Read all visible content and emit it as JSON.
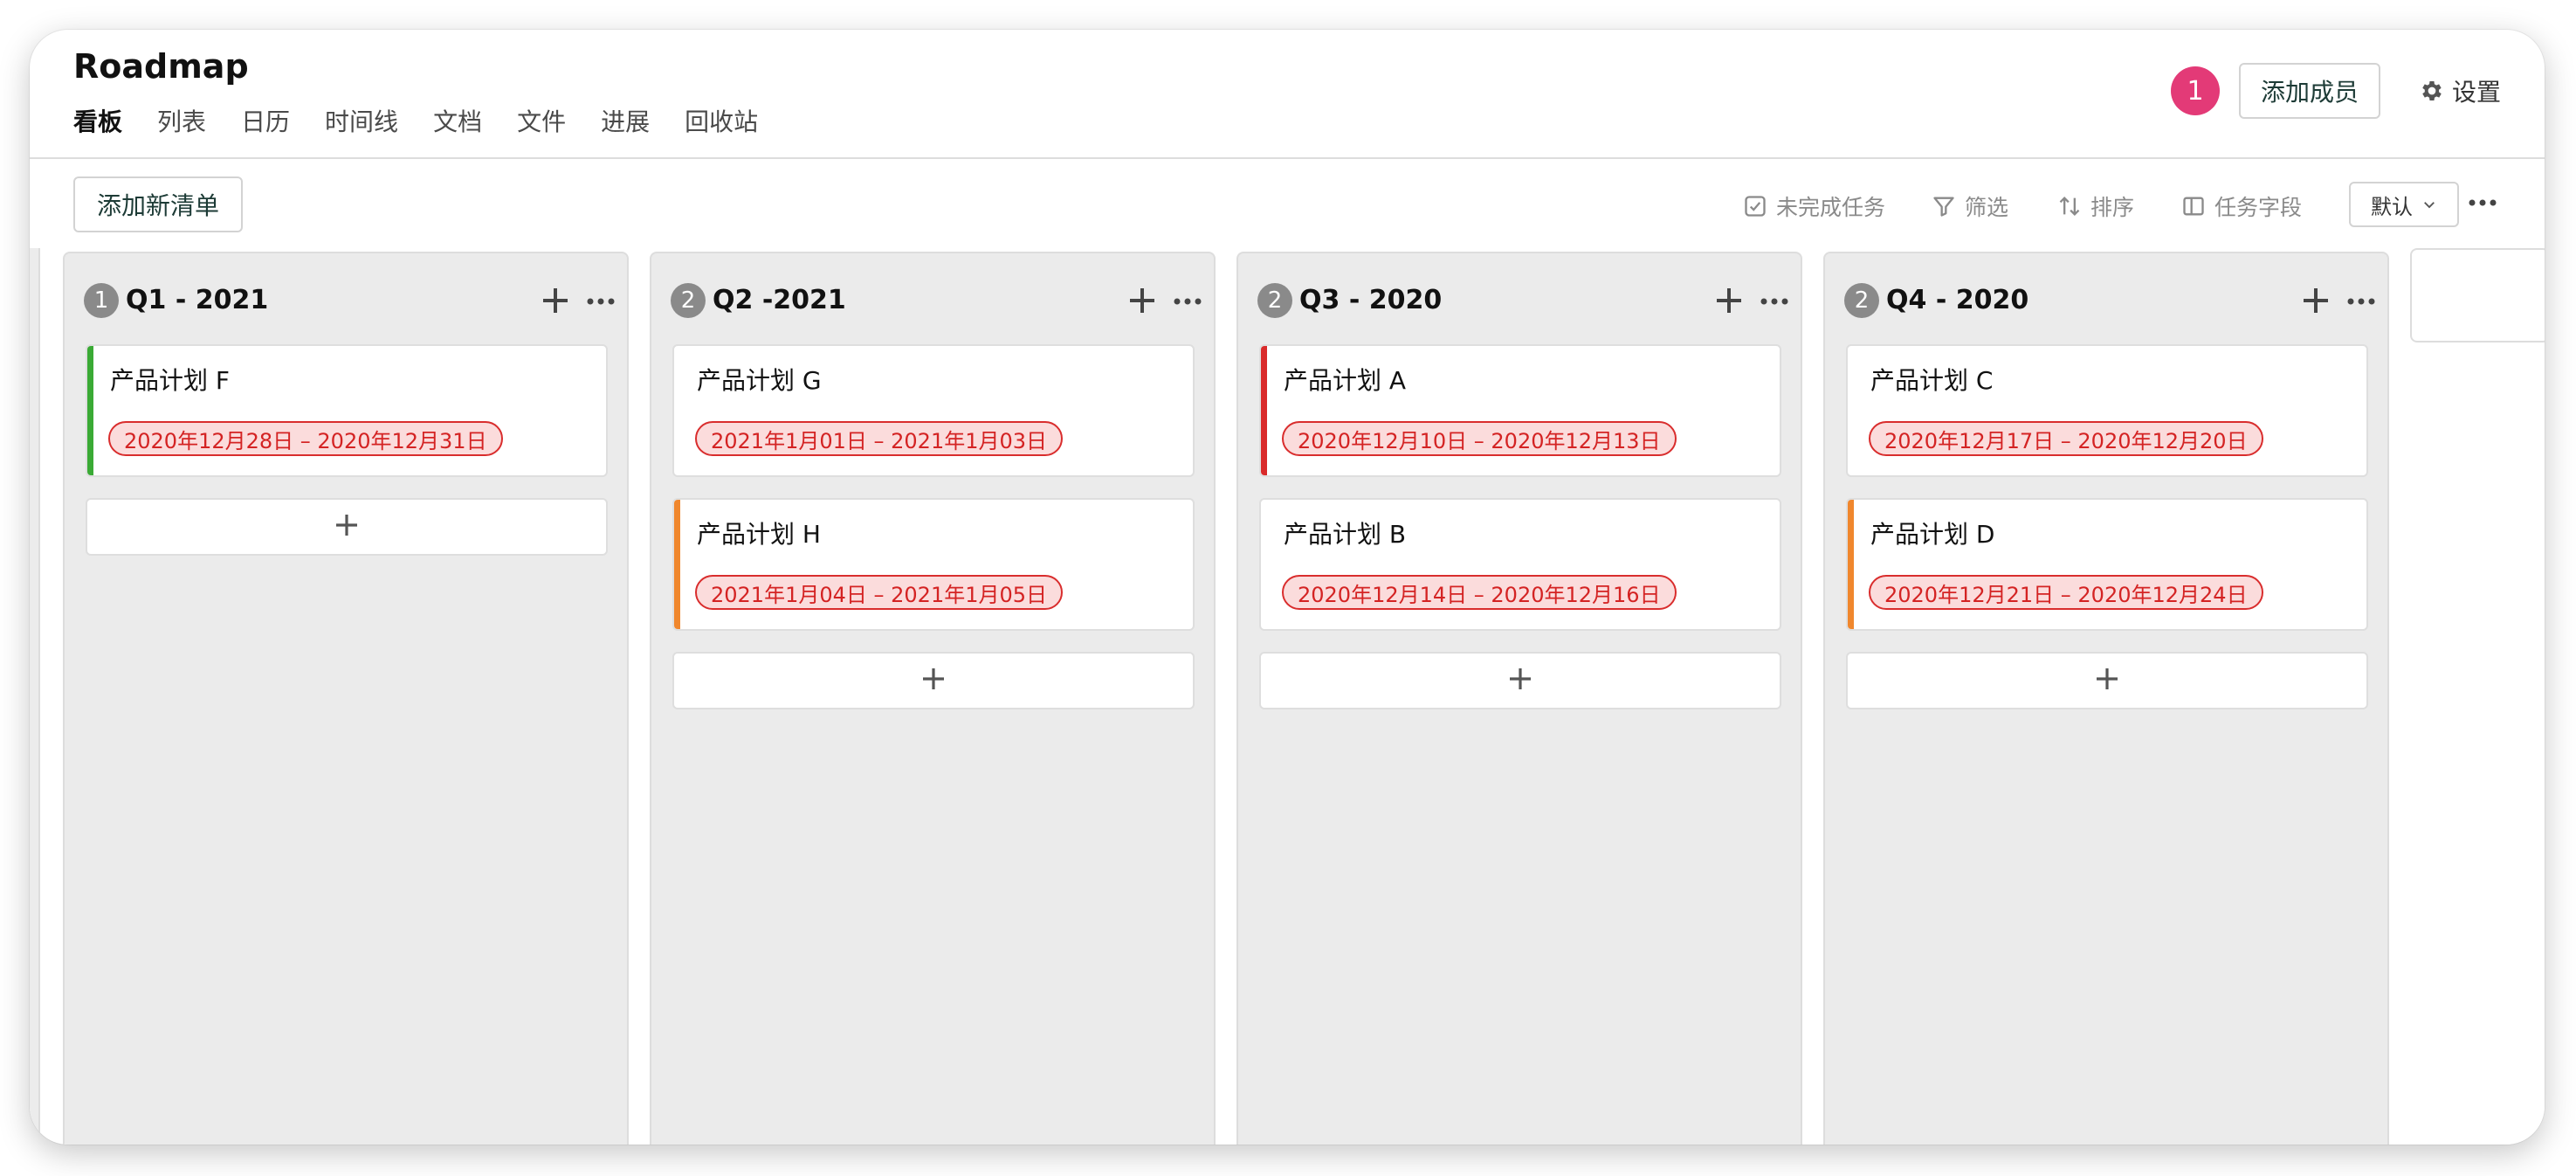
{
  "project": {
    "title": "Roadmap"
  },
  "tabs": [
    {
      "label": "看板"
    },
    {
      "label": "列表"
    },
    {
      "label": "日历"
    },
    {
      "label": "时间线"
    },
    {
      "label": "文档"
    },
    {
      "label": "文件"
    },
    {
      "label": "进展"
    },
    {
      "label": "回收站"
    }
  ],
  "header": {
    "member_count": "1",
    "add_member_label": "添加成员",
    "settings_label": "设置"
  },
  "toolbar": {
    "add_list_label": "添加新清单",
    "incomplete_tasks_label": "未完成任务",
    "filter_label": "筛选",
    "sort_label": "排序",
    "task_fields_label": "任务字段",
    "view_select_label": "默认"
  },
  "colors": {
    "green": "#3aaa35",
    "orange": "#f0872d",
    "red": "#d92a2a",
    "badge": "#e33a77"
  },
  "columns": [
    {
      "title": "Q1 - 2021",
      "count": "1",
      "cards": [
        {
          "title": "产品计划 F",
          "date": "2020年12月28日 – 2020年12月31日",
          "stripe": "green"
        }
      ]
    },
    {
      "title": "Q2 -2021",
      "count": "2",
      "cards": [
        {
          "title": "产品计划 G",
          "date": "2021年1月01日 – 2021年1月03日",
          "stripe": "none"
        },
        {
          "title": "产品计划 H",
          "date": "2021年1月04日 – 2021年1月05日",
          "stripe": "orange"
        }
      ]
    },
    {
      "title": "Q3 - 2020",
      "count": "2",
      "cards": [
        {
          "title": "产品计划 A",
          "date": "2020年12月10日 – 2020年12月13日",
          "stripe": "red"
        },
        {
          "title": "产品计划 B",
          "date": "2020年12月14日 – 2020年12月16日",
          "stripe": "none"
        }
      ]
    },
    {
      "title": "Q4 - 2020",
      "count": "2",
      "cards": [
        {
          "title": "产品计划 C",
          "date": "2020年12月17日 – 2020年12月20日",
          "stripe": "none"
        },
        {
          "title": "产品计划 D",
          "date": "2020年12月21日 – 2020年12月24日",
          "stripe": "orange"
        }
      ]
    }
  ]
}
